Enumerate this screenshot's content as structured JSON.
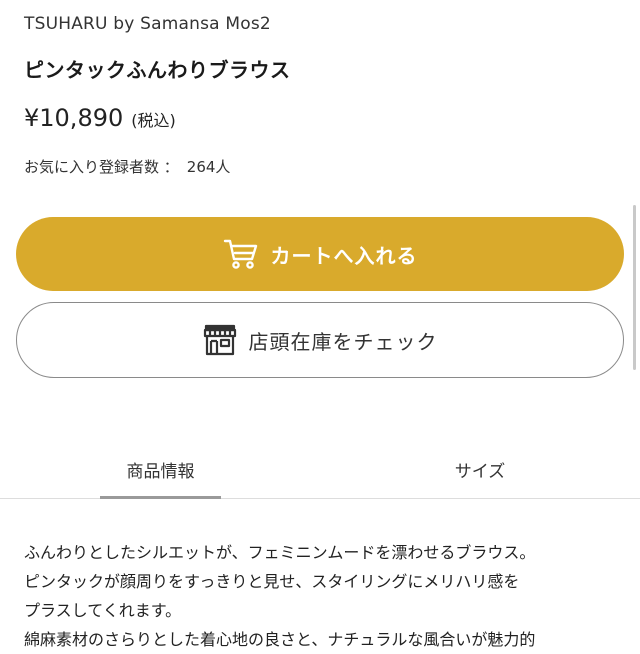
{
  "product": {
    "brand": "TSUHARU by Samansa Mos2",
    "title": "ピンタックふんわりブラウス",
    "price": "¥10,890",
    "tax_label": "(税込)",
    "favorite_label": "お気に入り登録者数 ：",
    "favorite_count": "264人"
  },
  "actions": {
    "cart_label": "カートへ入れる",
    "cart_icon": "cart-icon",
    "store_label": "店頭在庫をチェック",
    "store_icon": "storefront-icon",
    "cart_color": "#d9aa2c"
  },
  "tabs": {
    "items": [
      {
        "label": "商品情報",
        "active": true
      },
      {
        "label": "サイズ",
        "active": false
      }
    ]
  },
  "description": {
    "lines": [
      "ふんわりとしたシルエットが、フェミニンムードを漂わせるブラウス。",
      "ピンタックが顔周りをすっきりと見せ、スタイリングにメリハリ感を",
      "プラスしてくれます。",
      "綿麻素材のさらりとした着心地の良さと、ナチュラルな風合いが魅力的"
    ]
  }
}
